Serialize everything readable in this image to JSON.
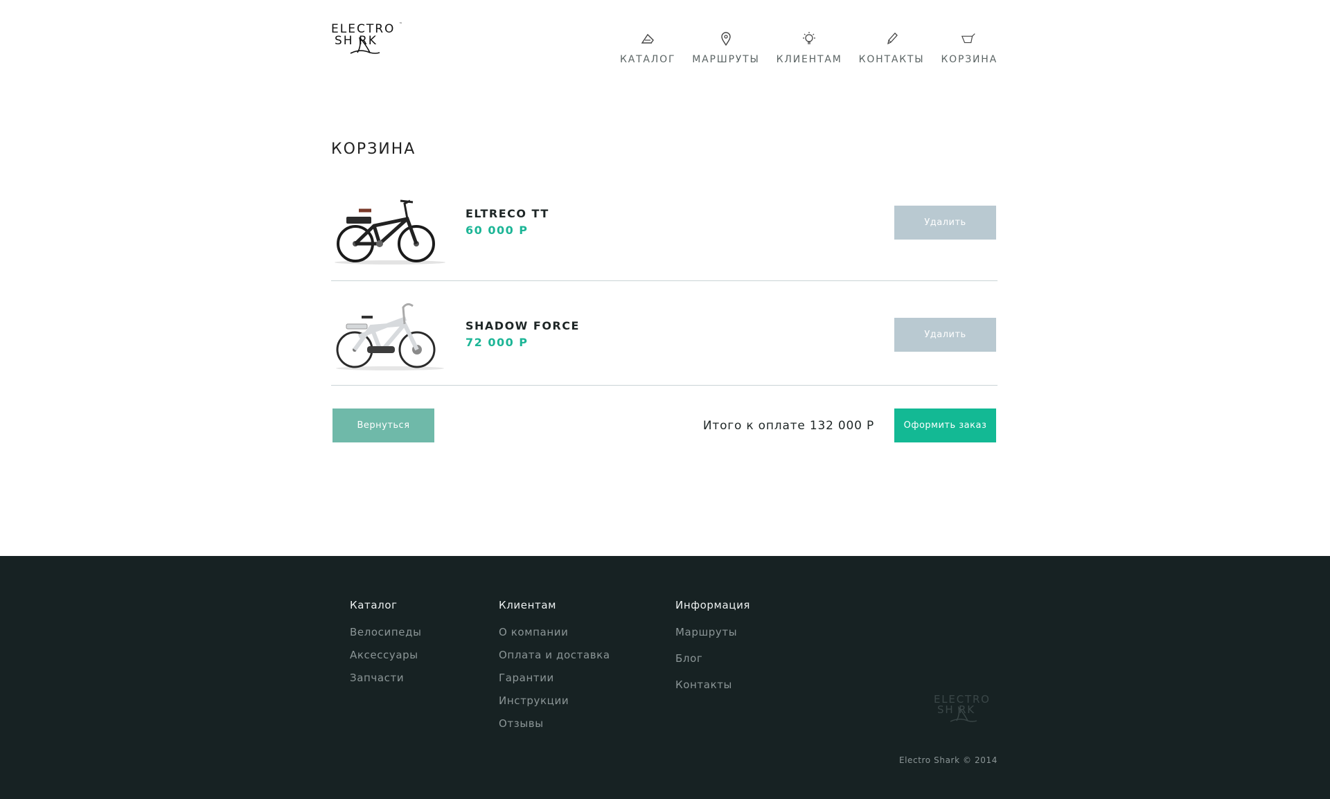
{
  "brand": {
    "line1": "ELECTRO",
    "line2": "SH RK",
    "tm": "™"
  },
  "nav": {
    "items": [
      {
        "label": "КАТАЛОГ",
        "icon": "catalog-icon"
      },
      {
        "label": "МАРШРУТЫ",
        "icon": "map-pin-icon"
      },
      {
        "label": "КЛИЕНТАМ",
        "icon": "lightbulb-icon"
      },
      {
        "label": "КОНТАКТЫ",
        "icon": "pencil-icon"
      },
      {
        "label": "КОРЗИНА",
        "icon": "cart-icon"
      }
    ]
  },
  "page_title": "КОРЗИНА",
  "cart": {
    "items": [
      {
        "name": "ELTRECO TT",
        "price": "60 000 Р",
        "delete_label": "Удалить",
        "image": "black-electric-bicycle"
      },
      {
        "name": "SHADOW FORCE",
        "price": "72 000 Р",
        "delete_label": "Удалить",
        "image": "white-electric-bicycle"
      }
    ],
    "back_label": "Вернуться",
    "total_label": "Итого к оплате 132 000 Р",
    "order_label": "Оформить заказ"
  },
  "footer": {
    "col1": {
      "title": "Каталог",
      "links": [
        "Велосипеды",
        "Аксессуары",
        "Запчасти"
      ]
    },
    "col2": {
      "title": "Клиентам",
      "links": [
        "О компании",
        "Оплата и доставка",
        "Гарантии",
        "Инструкции",
        "Отзывы"
      ]
    },
    "col3": {
      "title": "Информация",
      "links": [
        "Маршруты",
        "Блог",
        "Контакты"
      ]
    },
    "logo": {
      "line1": "ELECTRO",
      "line2": "SH RK"
    },
    "copyright": "Electro Shark © 2014"
  },
  "colors": {
    "accent": "#13b994",
    "price": "#1cb596",
    "delete_button": "#b9c9d1",
    "back_button": "#6fb9a9",
    "footer_bg": "#172223"
  }
}
